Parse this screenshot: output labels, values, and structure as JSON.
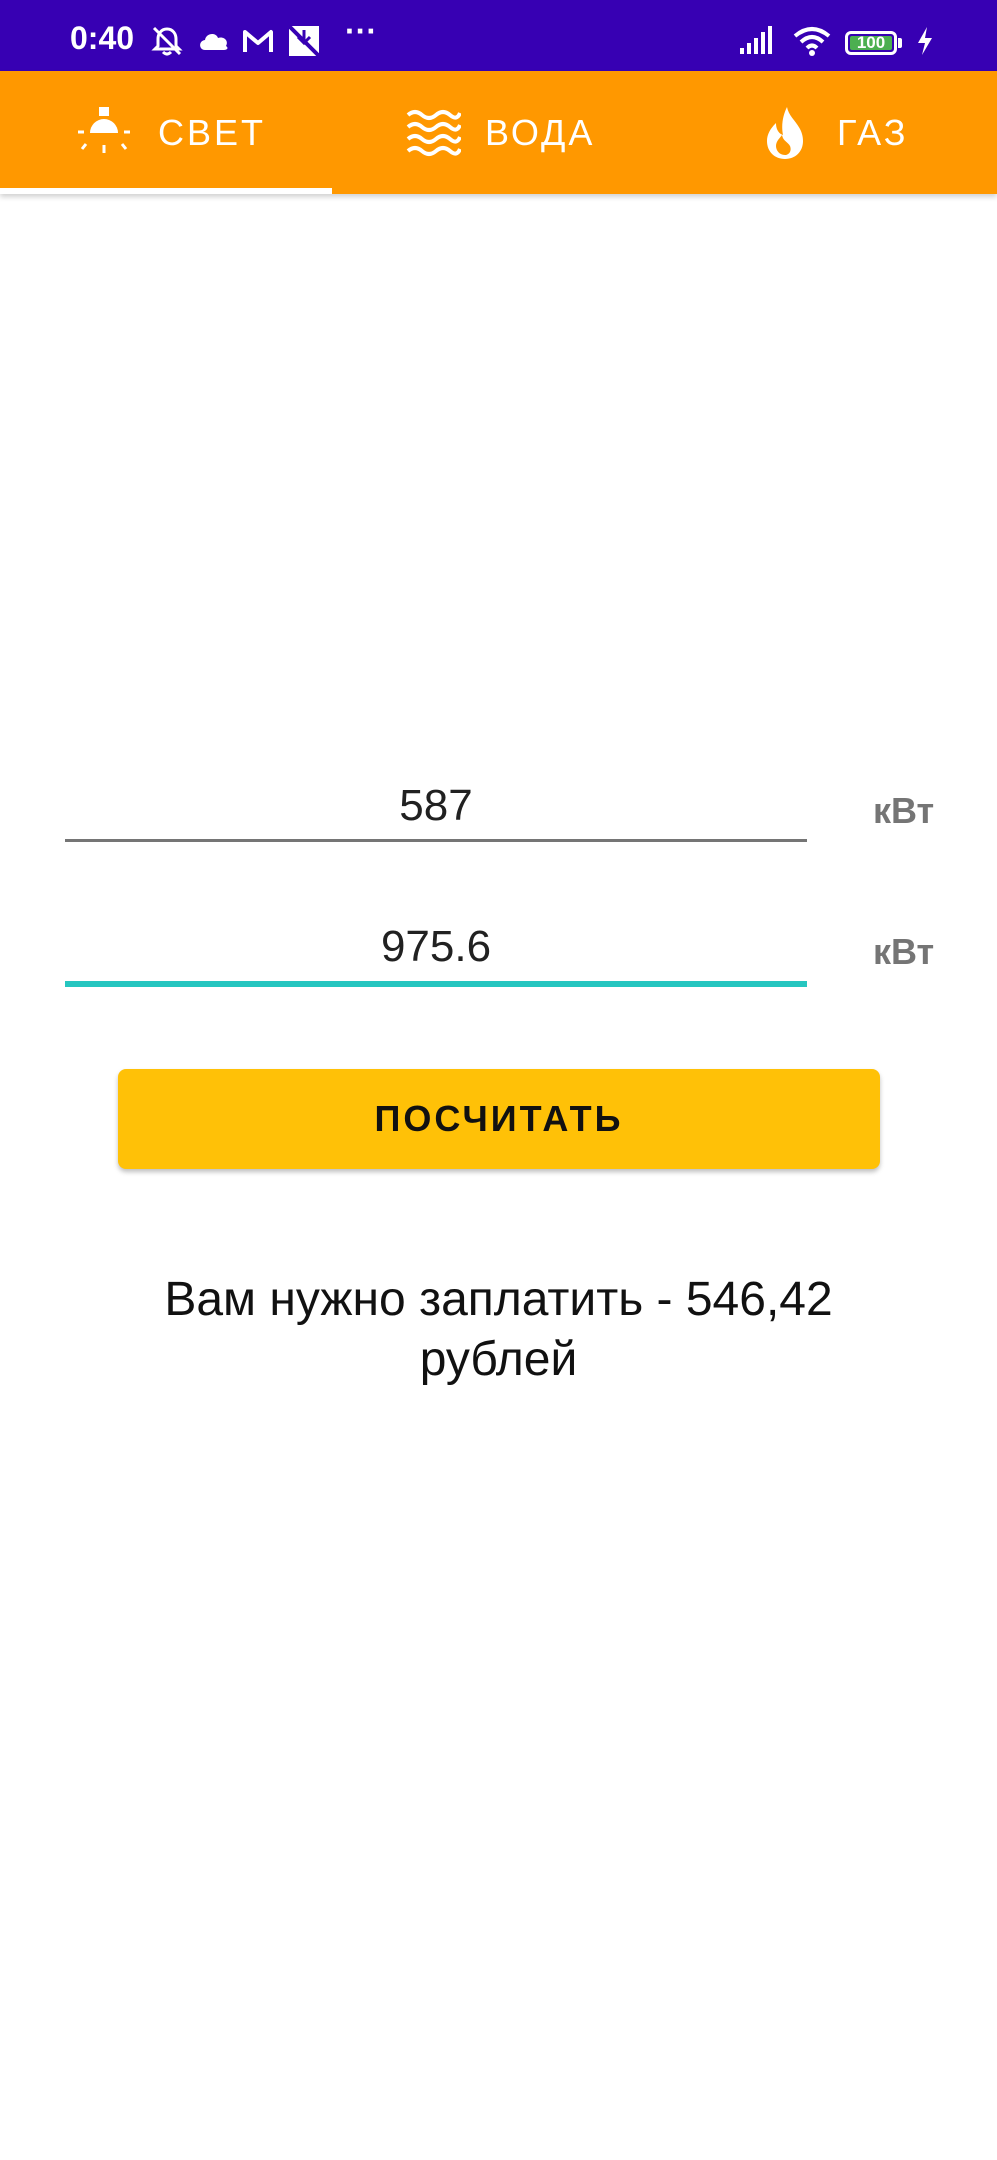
{
  "status_bar": {
    "time": "0:40",
    "icons": [
      "alarm-off-icon",
      "cloud-icon",
      "gmail-icon",
      "app-notification-icon",
      "more-dots-icon",
      "signal-icon",
      "wifi-icon",
      "battery-icon",
      "charging-icon"
    ],
    "more": "···",
    "battery_level": "100",
    "battery_fraction": 1.0
  },
  "tabs": [
    {
      "label": "СВЕТ",
      "icon": "light-bulb-icon",
      "selected": true
    },
    {
      "label": "ВОДА",
      "icon": "water-waves-icon",
      "selected": false
    },
    {
      "label": "ГАЗ",
      "icon": "flame-icon",
      "selected": false
    }
  ],
  "form": {
    "field1": {
      "value": "587",
      "unit": "кВт"
    },
    "field2": {
      "value": "975.6",
      "unit": "кВт",
      "focused": true
    },
    "button_label": "ПОСЧИТАТЬ"
  },
  "result": {
    "line1": "Вам нужно заплатить - 546,42",
    "line2": "рублей"
  },
  "colors": {
    "status_bar": "#3700b3",
    "tab_bar": "#ff9800",
    "button": "#ffc107",
    "focus_accent": "#26c6c0",
    "unit_text": "#757575"
  }
}
